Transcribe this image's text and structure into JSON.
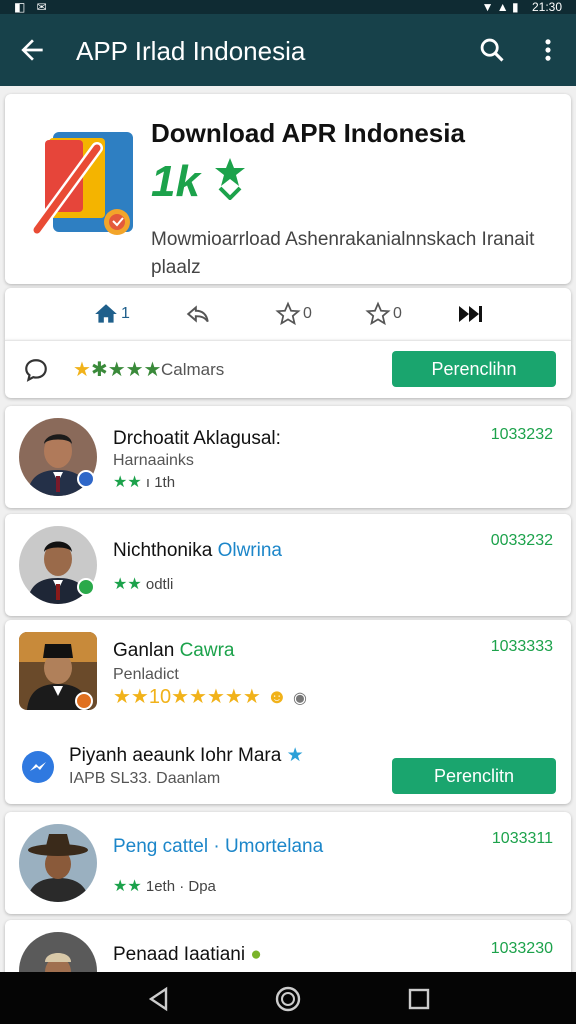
{
  "status": {
    "left_icons": "◧ ✉",
    "right_icons": "▼ ▲ ▮",
    "time": "21:30"
  },
  "appbar": {
    "title": "APP Irlad Indonesia"
  },
  "hero": {
    "title": "Download APR Indonesia",
    "subtitle": "1k",
    "description": "Mowmioarrload Ashenrakanialnnskach Iranait plaalz"
  },
  "actions": [
    {
      "count": "1"
    },
    {
      "count": ""
    },
    {
      "count": "0"
    },
    {
      "count": "0"
    }
  ],
  "rating": {
    "label": "Calmars",
    "button": "Perenclihn"
  },
  "people": [
    {
      "name": "Drchoatit Aklagusal:",
      "accent": "",
      "role": "Harnaainks",
      "meta": "ı 1th",
      "id": "1033232",
      "badge": "#2f67c8"
    },
    {
      "name": "Nichthonika",
      "accent": "Olwrina",
      "role": "",
      "meta": "odtli",
      "id": "0033232",
      "badge": "#2aa94a"
    },
    {
      "name": "Ganlan",
      "accent": "Cawra",
      "role": "Penladict",
      "meta": "",
      "id": "1033333",
      "badge": "#e07020"
    },
    {
      "name": "Peng cattel ·",
      "accent": "Umortelana",
      "role": "",
      "meta": "1eth · Dpa",
      "id": "1033311",
      "badge": ""
    },
    {
      "name": "Penaad Iaatiani",
      "accent": "",
      "role": "",
      "meta": "",
      "id": "1033230",
      "badge": ""
    }
  ],
  "promo": {
    "title": "Piyanh aeaunk Iohr Mara",
    "subtitle": "IAPB SL33. Daanlam",
    "button": "Perenclitn"
  },
  "colors": {
    "primary": "#17414a",
    "accent_green": "#1aa56e",
    "link_blue": "#1c86c9"
  }
}
